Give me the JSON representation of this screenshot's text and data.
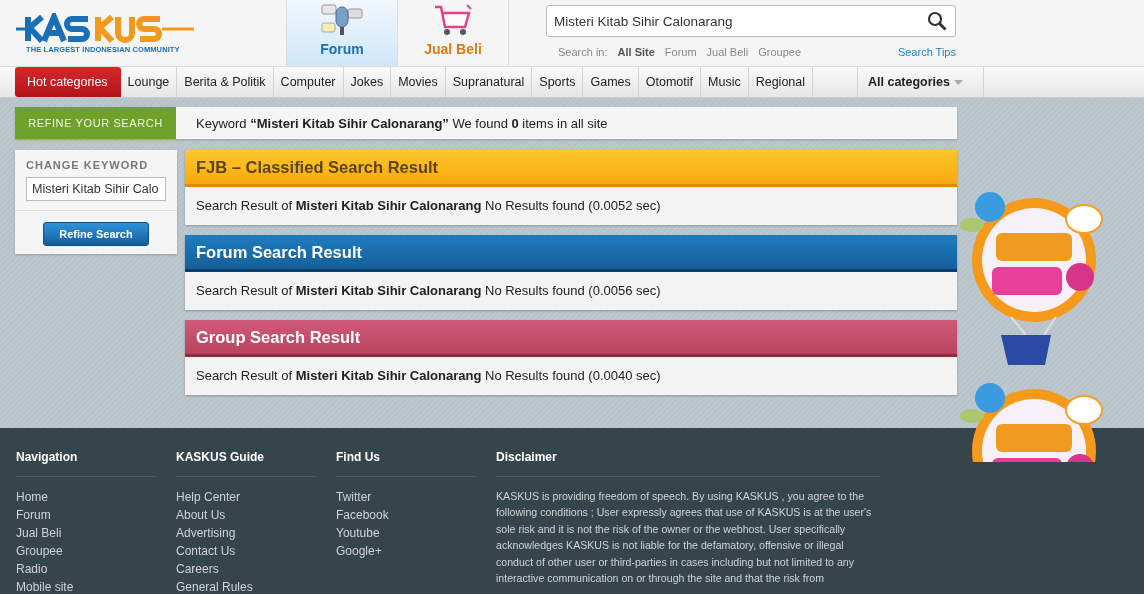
{
  "header": {
    "logo": {
      "tagline": "THE LARGEST INDONESIAN COMMUNITY"
    },
    "tabs": [
      {
        "label": "Forum",
        "kind": "forum",
        "selected": true
      },
      {
        "label": "Jual Beli",
        "kind": "cart",
        "selected": false
      }
    ],
    "search": {
      "value": "Misteri Kitab Sihir Calonarang",
      "scope_label": "Search in:",
      "scopes": [
        {
          "label": "All Site",
          "selected": true
        },
        {
          "label": "Forum",
          "selected": false
        },
        {
          "label": "Jual Beli",
          "selected": false
        },
        {
          "label": "Groupee",
          "selected": false
        }
      ],
      "tips": "Search Tips"
    }
  },
  "nav": {
    "items": [
      {
        "label": "Hot categories",
        "kind": "hot"
      },
      {
        "label": "Lounge",
        "kind": "plain"
      },
      {
        "label": "Berita & Politik",
        "kind": "plain"
      },
      {
        "label": "Computer",
        "kind": "plain"
      },
      {
        "label": "Jokes",
        "kind": "plain"
      },
      {
        "label": "Movies",
        "kind": "plain"
      },
      {
        "label": "Supranatural",
        "kind": "plain"
      },
      {
        "label": "Sports",
        "kind": "plain"
      },
      {
        "label": "Games",
        "kind": "plain"
      },
      {
        "label": "Otomotif",
        "kind": "plain"
      },
      {
        "label": "Music",
        "kind": "plain"
      },
      {
        "label": "Regional",
        "kind": "plain"
      },
      {
        "label": "All categories",
        "kind": "all"
      }
    ]
  },
  "refine": {
    "label": "REFINE YOUR SEARCH",
    "summary": "Keyword **“Misteri Kitab Sihir Calonarang”** We found **0** items in all site"
  },
  "sidebar": {
    "heading": "CHANGE KEYWORD",
    "value": "Misteri Kitab Sihir Calo",
    "button": "Refine Search"
  },
  "results": [
    {
      "title": "FJB – Classified Search Result",
      "kind": "fjb",
      "text": "Search Result of **Misteri Kitab Sihir Calonarang**  No Results found (0.0052 sec)"
    },
    {
      "title": "Forum Search Result",
      "kind": "forum",
      "text": "Search Result of **Misteri Kitab Sihir Calonarang** No Results found (0.0056 sec)"
    },
    {
      "title": "Group Search Result",
      "kind": "group",
      "text": "Search Result of **Misteri Kitab Sihir Calonarang** No Results found (0.0040 sec)"
    }
  ],
  "footer": {
    "columns": [
      {
        "heading": "Navigation",
        "links": [
          "Home",
          "Forum",
          "Jual Beli",
          "Groupee",
          "Radio",
          "Mobile site"
        ]
      },
      {
        "heading": "KASKUS Guide",
        "links": [
          "Help Center",
          "About Us",
          "Advertising",
          "Contact Us",
          "Careers",
          "General Rules"
        ]
      },
      {
        "heading": "Find Us",
        "links": [
          "Twitter",
          "Facebook",
          "Youtube",
          "Google+"
        ]
      }
    ],
    "disclaimer": {
      "heading": "Disclaimer",
      "text": "KASKUS is providing freedom of speech. By using KASKUS , you agree to the following conditions ; User expressly agrees that use of KASKUS is at the user's sole risk and it is not the risk of the owner or the webhost. User specifically acknowledges KASKUS is not liable for the defamatory, offensive or illegal conduct of other user or third-parties in cases including but not limited to any interactive communication on or through the site and that the risk from"
    }
  }
}
